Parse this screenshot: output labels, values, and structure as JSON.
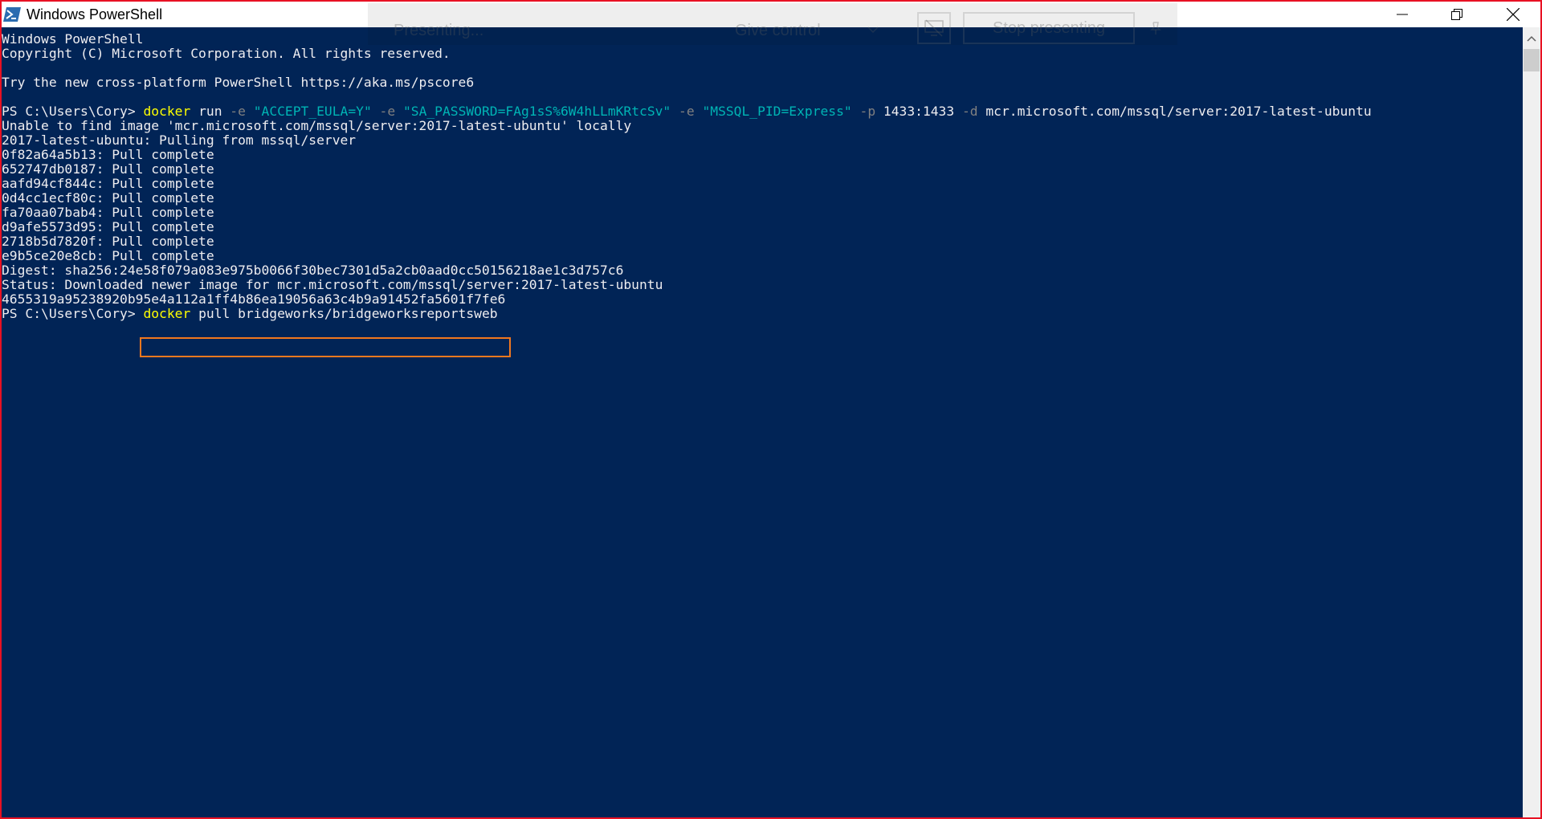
{
  "window": {
    "title": "Windows PowerShell",
    "border_color": "#e81123",
    "console_bg": "#012456"
  },
  "presenting_bar": {
    "status": "Presenting...",
    "give_control": "Give control",
    "stop": "Stop presenting"
  },
  "console": {
    "lines": [
      "Windows PowerShell",
      "Copyright (C) Microsoft Corporation. All rights reserved.",
      "",
      "Try the new cross-platform PowerShell https://aka.ms/pscore6",
      "",
      "",
      "Unable to find image 'mcr.microsoft.com/mssql/server:2017-latest-ubuntu' locally",
      "2017-latest-ubuntu: Pulling from mssql/server",
      "0f82a64a5b13: Pull complete",
      "652747db0187: Pull complete",
      "aafd94cf844c: Pull complete",
      "0d4cc1ecf80c: Pull complete",
      "fa70aa07bab4: Pull complete",
      "d9afe5573d95: Pull complete",
      "2718b5d7820f: Pull complete",
      "e9b5ce20e8cb: Pull complete",
      "Digest: sha256:24e58f079a083e975b0066f30bec7301d5a2cb0aad0cc50156218ae1c3d757c6",
      "Status: Downloaded newer image for mcr.microsoft.com/mssql/server:2017-latest-ubuntu",
      "4655319a95238920b95e4a112a1ff4b86ea19056a63c4b9a91452fa5601f7fe6"
    ],
    "command1": {
      "prompt": "PS C:\\Users\\Cory> ",
      "cmd": "docker",
      "t1": " run ",
      "p1": "-e",
      "s1": " \"ACCEPT_EULA=Y\" ",
      "p2": "-e",
      "s2": " \"SA_PASSWORD=FAg1sS%6W4hLLmKRtcSv\" ",
      "p3": "-e",
      "s3": " \"MSSQL_PID=Express\" ",
      "p4": "-p",
      "t2": " 1433:1433 ",
      "p5": "-d",
      "t3": " mcr.microsoft.com/mssql/server:2017-latest-ubuntu"
    },
    "command2": {
      "prompt": "PS C:\\Users\\Cory> ",
      "cmd": "docker",
      "rest": " pull bridgeworks/bridgeworksreportsweb"
    },
    "highlight_color": "#f0781e"
  }
}
